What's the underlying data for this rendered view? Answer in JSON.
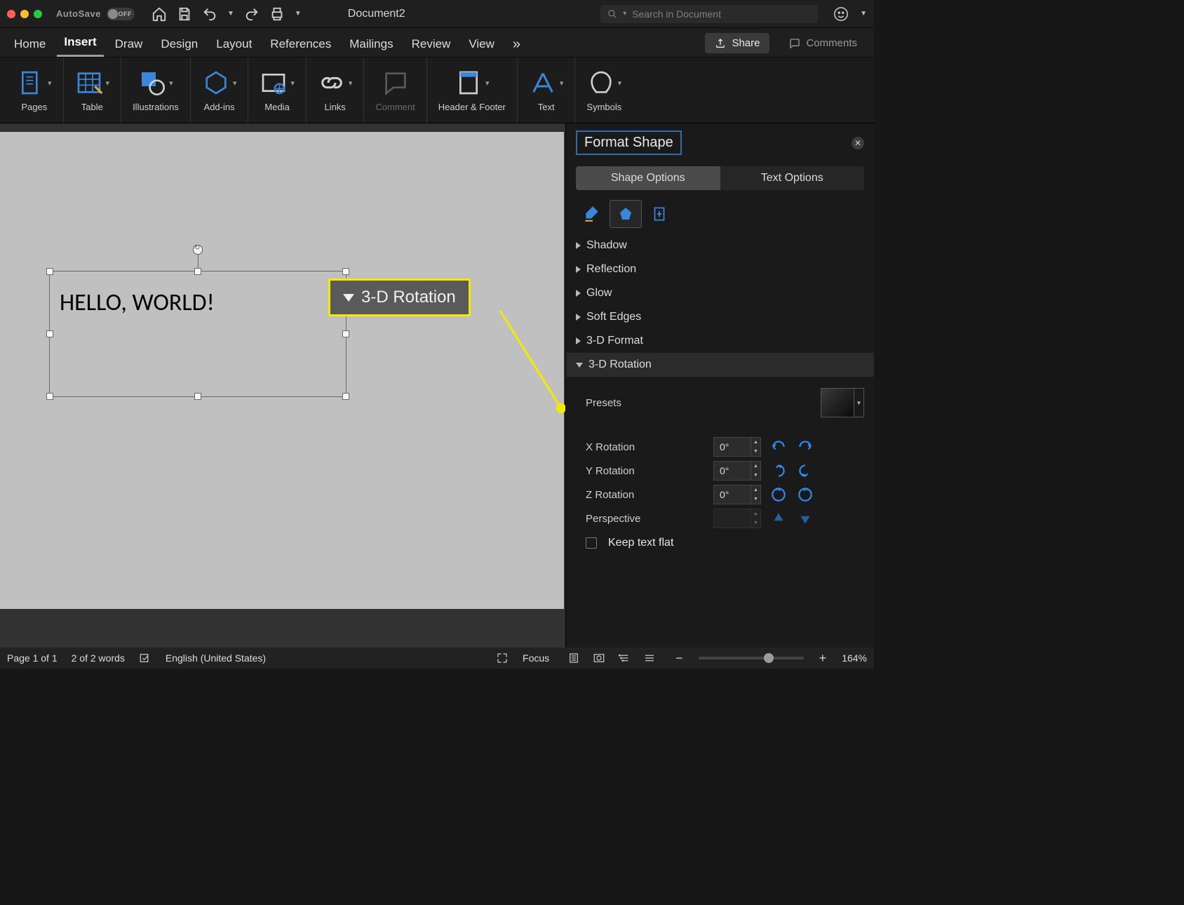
{
  "titlebar": {
    "autosave_label": "AutoSave",
    "autosave_state": "OFF",
    "doc_title": "Document2",
    "search_placeholder": "Search in Document"
  },
  "ribbon_tabs": [
    "Home",
    "Insert",
    "Draw",
    "Design",
    "Layout",
    "References",
    "Mailings",
    "Review",
    "View"
  ],
  "ribbon_active_tab": "Insert",
  "ribbon_right": {
    "share": "Share",
    "comments": "Comments"
  },
  "ribbon_groups": [
    "Pages",
    "Table",
    "Illustrations",
    "Add-ins",
    "Media",
    "Links",
    "Comment",
    "Header & Footer",
    "Text",
    "Symbols"
  ],
  "textbox_content": "HELLO, WORLD!",
  "callout_label": "3-D Rotation",
  "format_pane": {
    "title": "Format Shape",
    "tabs": [
      "Shape Options",
      "Text Options"
    ],
    "active_tab": 0,
    "sections": [
      "Shadow",
      "Reflection",
      "Glow",
      "Soft Edges",
      "3-D Format",
      "3-D Rotation"
    ],
    "open_section": 5,
    "presets_label": "Presets",
    "rows": [
      {
        "label": "X Rotation",
        "value": "0°"
      },
      {
        "label": "Y Rotation",
        "value": "0°"
      },
      {
        "label": "Z Rotation",
        "value": "0°"
      },
      {
        "label": "Perspective",
        "value": ""
      }
    ],
    "keep_flat_label": "Keep text flat"
  },
  "statusbar": {
    "page": "Page 1 of 1",
    "words": "2 of 2 words",
    "lang": "English (United States)",
    "focus": "Focus",
    "zoom": "164%"
  }
}
